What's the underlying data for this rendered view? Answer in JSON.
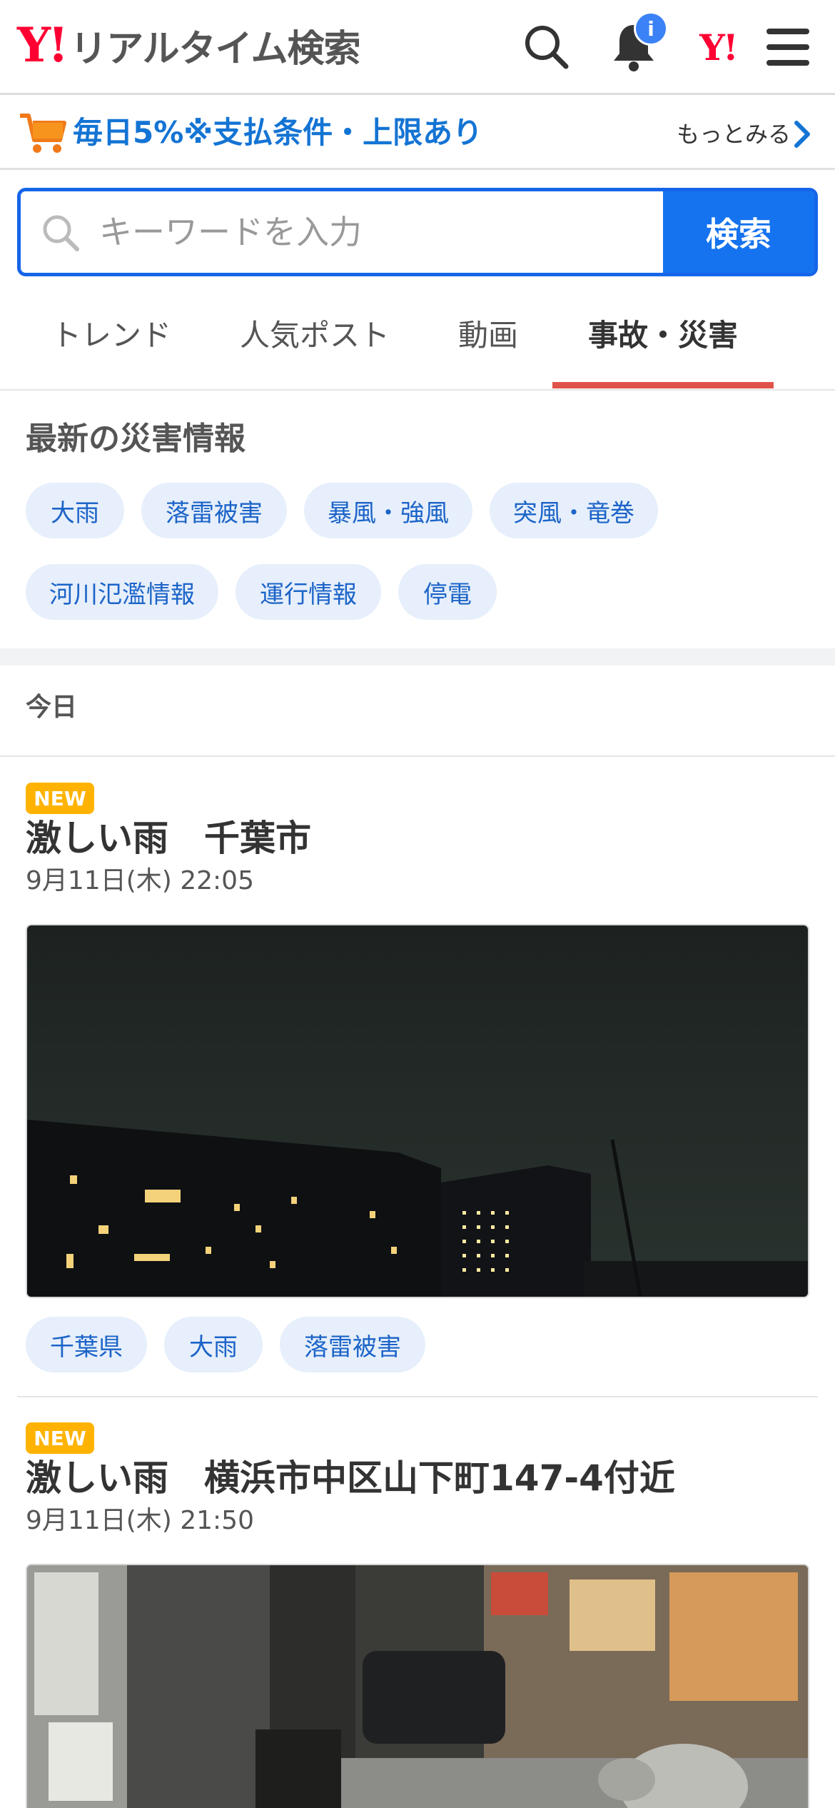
{
  "header": {
    "logo_mark": "Y!",
    "logo_text": "リアルタイム検索",
    "notification_badge": "i",
    "yahoo_mark": "Y!"
  },
  "promo": {
    "text": "毎日5%※支払条件・上限あり",
    "more_label": "もっとみる"
  },
  "search": {
    "placeholder": "キーワードを入力",
    "button_label": "検索"
  },
  "tabs": [
    {
      "label": "トレンド",
      "active": false
    },
    {
      "label": "人気ポスト",
      "active": false
    },
    {
      "label": "動画",
      "active": false
    },
    {
      "label": "事故・災害",
      "active": true
    }
  ],
  "disaster": {
    "title": "最新の災害情報",
    "chips": [
      "大雨",
      "落雷被害",
      "暴風・強風",
      "突風・竜巻",
      "河川氾濫情報",
      "運行情報",
      "停電"
    ]
  },
  "date_header": "今日",
  "posts": [
    {
      "badge": "NEW",
      "title": "激しい雨　千葉市",
      "time": "9月11日(木) 22:05",
      "tags": [
        "千葉県",
        "大雨",
        "落雷被害"
      ]
    },
    {
      "badge": "NEW",
      "title": "激しい雨　横浜市中区山下町147-4付近",
      "time": "9月11日(木) 21:50",
      "tags": []
    }
  ],
  "colors": {
    "brand_red": "#ff0033",
    "search_blue": "#1573ef",
    "tab_active_underline": "#e0534a",
    "chip_bg": "#e6effb",
    "chip_text": "#1c64c8",
    "new_badge": "#ffb300",
    "promo_text": "#1474d4"
  }
}
